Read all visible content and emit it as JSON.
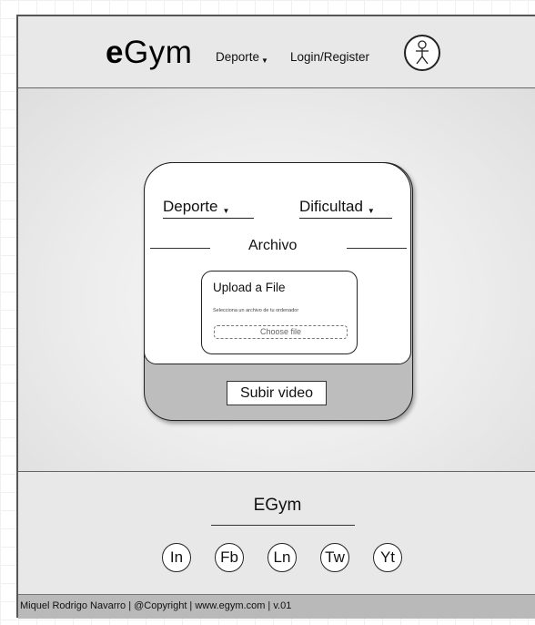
{
  "header": {
    "logo_bold": "e",
    "logo_rest": "Gym",
    "nav": {
      "deporte": "Deporte",
      "login": "Login/Register"
    },
    "avatar_icon": "user-stick-figure-icon"
  },
  "form": {
    "deporte_select": "Deporte",
    "dificultad_select": "Dificultad",
    "section_title": "Archivo",
    "upload": {
      "title": "Upload a File",
      "help": "Selecciona un archivo de tu ordenador",
      "choose_button": "Choose file"
    },
    "submit_button": "Subir video"
  },
  "footer": {
    "title": "EGym",
    "social": [
      "In",
      "Fb",
      "Ln",
      "Tw",
      "Yt"
    ]
  },
  "bottom_bar": {
    "text": "Miquel Rodrigo Navarro | @Copyright | www.egym.com | v.01"
  }
}
